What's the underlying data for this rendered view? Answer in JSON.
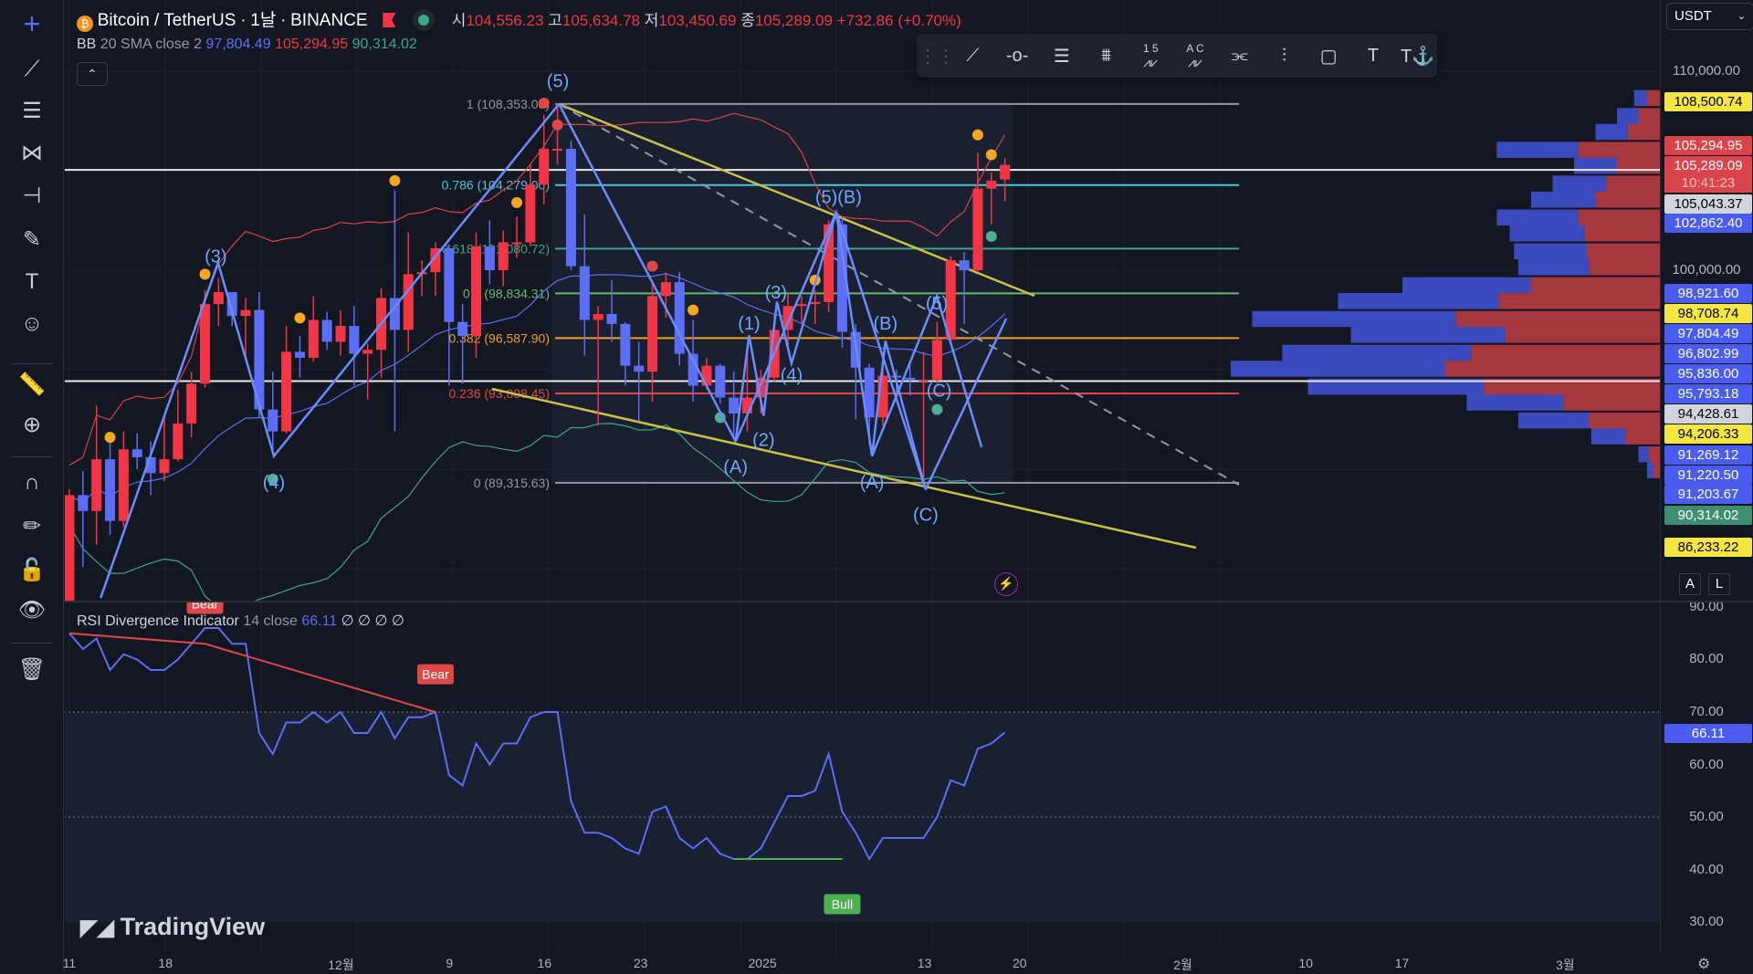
{
  "header": {
    "symbol": "Bitcoin / TetherUS",
    "sep1": "·",
    "interval": "1날",
    "sep2": "·",
    "exchange": "BINANCE",
    "o_label": "시",
    "o": "104,556.23",
    "h_label": "고",
    "h": "105,634.78",
    "l_label": "저",
    "l": "103,450.69",
    "c_label": "종",
    "c": "105,289.09",
    "change": "+732.86 (+0.70%)"
  },
  "bb_legend": {
    "name": "BB",
    "params": "20 SMA close 2",
    "basis": "97,804.49",
    "upper": "105,294.95",
    "lower": "90,314.02"
  },
  "rsi_legend": {
    "name": "RSI Divergence Indicator",
    "params": "14 close",
    "value": "66.11",
    "extras": "∅ ∅ ∅ ∅"
  },
  "currency": "USDT",
  "scale_buttons": [
    "A",
    "L"
  ],
  "logo": "TradingView",
  "colors": {
    "up": "#f23645",
    "down": "#5b6ef5",
    "bg": "#131722",
    "fib_gray": "#9598a1",
    "trend": "#c9c148",
    "wave": "#6a8cff"
  },
  "price_ticks": [
    "110,000.00",
    "100,000.00"
  ],
  "rsi_ticks": [
    "90.00",
    "80.00",
    "70.00",
    "60.00",
    "50.00",
    "40.00",
    "30.00"
  ],
  "price_labels": [
    {
      "text": "108,500.74",
      "bg": "#f5e642",
      "fg": "#000"
    },
    {
      "text": "105,294.95",
      "bg": "#d9434a",
      "fg": "#fff"
    },
    {
      "text": "105,289.09",
      "bg": "#d9434a",
      "fg": "#fff"
    },
    {
      "text": "10:41:23",
      "bg": "#d9434a",
      "fg": "#f3c1c3"
    },
    {
      "text": "105,043.37",
      "bg": "#d1d4dc",
      "fg": "#000"
    },
    {
      "text": "102,862.40",
      "bg": "#4a5cf0",
      "fg": "#fff"
    },
    {
      "text": "98,921.60",
      "bg": "#4a5cf0",
      "fg": "#fff"
    },
    {
      "text": "98,708.74",
      "bg": "#f5e642",
      "fg": "#000"
    },
    {
      "text": "97,804.49",
      "bg": "#4a5cf0",
      "fg": "#fff"
    },
    {
      "text": "96,802.99",
      "bg": "#4a5cf0",
      "fg": "#fff"
    },
    {
      "text": "95,836.00",
      "bg": "#4a5cf0",
      "fg": "#fff"
    },
    {
      "text": "95,793.18",
      "bg": "#4a5cf0",
      "fg": "#fff"
    },
    {
      "text": "94,428.61",
      "bg": "#d1d4dc",
      "fg": "#000"
    },
    {
      "text": "94,206.33",
      "bg": "#f5e642",
      "fg": "#000"
    },
    {
      "text": "91,269.12",
      "bg": "#4a5cf0",
      "fg": "#fff"
    },
    {
      "text": "91,220.50",
      "bg": "#4a5cf0",
      "fg": "#fff"
    },
    {
      "text": "91,203.67",
      "bg": "#4a5cf0",
      "fg": "#fff"
    },
    {
      "text": "90,314.02",
      "bg": "#3d8f70",
      "fg": "#fff"
    },
    {
      "text": "86,233.22",
      "bg": "#f5e642",
      "fg": "#000"
    }
  ],
  "rsi_label": {
    "text": "66.11",
    "bg": "#4a5cf0",
    "fg": "#fff"
  },
  "time_labels": [
    "11",
    "18",
    "12월",
    "9",
    "16",
    "23",
    "2025",
    "13",
    "20",
    "2월",
    "10",
    "17",
    "3월"
  ],
  "left_toolbar": [
    "crosshair",
    "trend-line",
    "fib-retracement",
    "pattern",
    "forecast",
    "brush",
    "text",
    "emoji",
    "ruler",
    "zoom-in",
    "magnet",
    "lock-drawings",
    "unlock",
    "eye",
    "trash"
  ],
  "floating_toolbar": [
    "drag-handle",
    "trend-line",
    "horizontal-ray",
    "fib-retracement",
    "fib-extension",
    "elliott-impulse",
    "elliott-correction",
    "parallel-channel",
    "regression",
    "rectangle",
    "text",
    "anchored-text"
  ],
  "floating_toolbar_text": {
    "impulse": "1 5",
    "correction": "A C"
  },
  "chart_data": {
    "type": "candlestick",
    "title": "Bitcoin / TetherUS · 1D · BINANCE",
    "unit": "thousand USDT",
    "x_start": "2024-11-11",
    "x_end": "2025-01-19",
    "ohlc": [
      [
        80.4,
        89.0,
        80.2,
        88.7
      ],
      [
        88.7,
        89.9,
        85.1,
        87.9
      ],
      [
        87.9,
        93.2,
        86.2,
        90.5
      ],
      [
        90.5,
        91.8,
        86.7,
        87.4
      ],
      [
        87.4,
        91.9,
        87.1,
        91.0
      ],
      [
        91.0,
        91.8,
        90.0,
        90.6
      ],
      [
        90.6,
        91.4,
        88.7,
        89.8
      ],
      [
        89.8,
        92.6,
        89.4,
        90.5
      ],
      [
        90.5,
        94.0,
        90.4,
        92.3
      ],
      [
        92.3,
        94.9,
        91.6,
        94.3
      ],
      [
        94.3,
        99.0,
        94.1,
        98.3
      ],
      [
        98.3,
        99.6,
        97.2,
        98.9
      ],
      [
        98.9,
        98.9,
        97.2,
        97.7
      ],
      [
        97.7,
        98.6,
        95.7,
        98.0
      ],
      [
        98.0,
        98.9,
        92.6,
        93.0
      ],
      [
        93.0,
        94.9,
        90.8,
        91.9
      ],
      [
        91.9,
        97.2,
        91.8,
        95.9
      ],
      [
        95.9,
        96.7,
        94.6,
        95.6
      ],
      [
        95.6,
        98.7,
        95.4,
        97.5
      ],
      [
        97.5,
        97.9,
        96.0,
        96.4
      ],
      [
        96.4,
        98.0,
        95.7,
        97.2
      ],
      [
        97.2,
        98.2,
        94.2,
        95.8
      ],
      [
        95.8,
        96.3,
        93.5,
        96.0
      ],
      [
        96.0,
        99.1,
        94.6,
        98.6
      ],
      [
        98.6,
        104.0,
        91.9,
        97.0
      ],
      [
        97.0,
        101.9,
        95.9,
        99.8
      ],
      [
        99.8,
        100.5,
        98.7,
        99.9
      ],
      [
        99.9,
        101.4,
        98.7,
        101.1
      ],
      [
        101.1,
        101.3,
        94.2,
        97.4
      ],
      [
        97.4,
        98.3,
        94.3,
        96.7
      ],
      [
        96.7,
        101.9,
        95.6,
        101.2
      ],
      [
        101.2,
        102.5,
        99.3,
        100.0
      ],
      [
        100.0,
        102.0,
        99.2,
        101.4
      ],
      [
        101.4,
        102.7,
        100.6,
        101.4
      ],
      [
        101.4,
        105.3,
        101.2,
        104.3
      ],
      [
        104.3,
        107.8,
        103.3,
        106.1
      ],
      [
        106.1,
        108.4,
        105.3,
        106.1
      ],
      [
        106.1,
        106.5,
        100.0,
        100.2
      ],
      [
        100.2,
        102.8,
        95.7,
        97.5
      ],
      [
        97.5,
        98.2,
        92.2,
        97.8
      ],
      [
        97.8,
        99.5,
        96.4,
        97.3
      ],
      [
        97.3,
        97.4,
        94.2,
        95.2
      ],
      [
        95.2,
        96.4,
        92.4,
        94.9
      ],
      [
        94.9,
        99.4,
        93.4,
        98.7
      ],
      [
        98.7,
        99.9,
        97.6,
        99.4
      ],
      [
        99.4,
        99.9,
        95.2,
        95.8
      ],
      [
        95.8,
        97.5,
        93.4,
        94.2
      ],
      [
        94.2,
        95.6,
        94.0,
        95.2
      ],
      [
        95.2,
        95.3,
        93.3,
        93.6
      ],
      [
        93.6,
        94.9,
        91.5,
        92.8
      ],
      [
        92.8,
        96.1,
        91.9,
        93.6
      ],
      [
        93.6,
        95.0,
        92.8,
        94.6
      ],
      [
        94.6,
        97.8,
        94.4,
        97.0
      ],
      [
        97.0,
        98.9,
        96.2,
        98.2
      ],
      [
        98.2,
        98.7,
        97.3,
        98.3
      ],
      [
        98.3,
        99.0,
        97.3,
        98.4
      ],
      [
        98.4,
        102.5,
        97.9,
        102.3
      ],
      [
        102.3,
        102.7,
        96.1,
        96.9
      ],
      [
        96.9,
        97.3,
        92.5,
        95.1
      ],
      [
        95.1,
        95.3,
        91.2,
        92.6
      ],
      [
        92.6,
        95.8,
        92.2,
        94.7
      ],
      [
        94.7,
        95.0,
        93.8,
        94.6
      ],
      [
        94.6,
        95.4,
        93.7,
        94.5
      ],
      [
        94.5,
        95.9,
        89.3,
        94.5
      ],
      [
        94.5,
        97.4,
        94.3,
        96.5
      ],
      [
        96.5,
        100.7,
        96.5,
        100.5
      ],
      [
        100.5,
        100.9,
        97.3,
        99.99
      ],
      [
        100.0,
        105.9,
        99.9,
        104.1
      ],
      [
        104.1,
        104.9,
        102.3,
        104.5
      ],
      [
        104.56,
        105.63,
        103.45,
        105.29
      ]
    ],
    "rsi": [
      85,
      82,
      84,
      78,
      81,
      80,
      78,
      78,
      80,
      83,
      86,
      86,
      83,
      83,
      66,
      62,
      68,
      68,
      70,
      68,
      70,
      66,
      66,
      70,
      65,
      69,
      69,
      70,
      58,
      56,
      64,
      60,
      64,
      64,
      69,
      70,
      70,
      53,
      47,
      47,
      46,
      44,
      43,
      51,
      52,
      46,
      44,
      46,
      43,
      42,
      42,
      44,
      49,
      54,
      54,
      55,
      62,
      51,
      47,
      42,
      46,
      46,
      46,
      46,
      50,
      57,
      56,
      63,
      64,
      66.11
    ],
    "rsi_ylim": [
      30,
      90
    ],
    "price_ylim": [
      84,
      111
    ],
    "fib_levels": [
      {
        "ratio": "1",
        "price": "108,353.00",
        "color": "#9598a1"
      },
      {
        "ratio": "0.786",
        "price": "104,279.00",
        "color": "#4fc3d9"
      },
      {
        "ratio": "0.618",
        "price": "101,080.72",
        "color": "#3fa58c"
      },
      {
        "ratio": "0.5",
        "price": "98,834.31",
        "color": "#66bb6a"
      },
      {
        "ratio": "0.382",
        "price": "96,587.90",
        "color": "#f0a020"
      },
      {
        "ratio": "0.236",
        "price": "93,808.45",
        "color": "#e04848"
      },
      {
        "ratio": "0",
        "price": "89,315.63",
        "color": "#9598a1"
      }
    ],
    "wave_labels": [
      "(5)",
      "(3)",
      "(4)",
      "(A)",
      "(1)",
      "(2)",
      "(3)",
      "(4)",
      "(5)(B)",
      "(B)",
      "(A)",
      "(C)",
      "(C)",
      "(5)"
    ],
    "divergences": [
      {
        "label": "Bear",
        "color": "#e04848"
      },
      {
        "label": "Bear",
        "color": "#e04848"
      },
      {
        "label": "Bull",
        "color": "#4caf50"
      }
    ],
    "volume_profile": [
      [
        108.2,
        0.06
      ],
      [
        107.3,
        0.1
      ],
      [
        106.5,
        0.15
      ],
      [
        105.6,
        0.38
      ],
      [
        104.8,
        0.2
      ],
      [
        103.9,
        0.25
      ],
      [
        103.1,
        0.3
      ],
      [
        102.2,
        0.38
      ],
      [
        101.4,
        0.35
      ],
      [
        100.5,
        0.34
      ],
      [
        99.7,
        0.33
      ],
      [
        98.8,
        0.6
      ],
      [
        98.0,
        0.75
      ],
      [
        97.1,
        0.95
      ],
      [
        96.3,
        0.72
      ],
      [
        95.4,
        0.88
      ],
      [
        94.6,
        1.0
      ],
      [
        93.7,
        0.82
      ],
      [
        92.9,
        0.45
      ],
      [
        92.0,
        0.33
      ],
      [
        91.2,
        0.16
      ],
      [
        90.3,
        0.05
      ],
      [
        89.5,
        0.03
      ]
    ]
  }
}
